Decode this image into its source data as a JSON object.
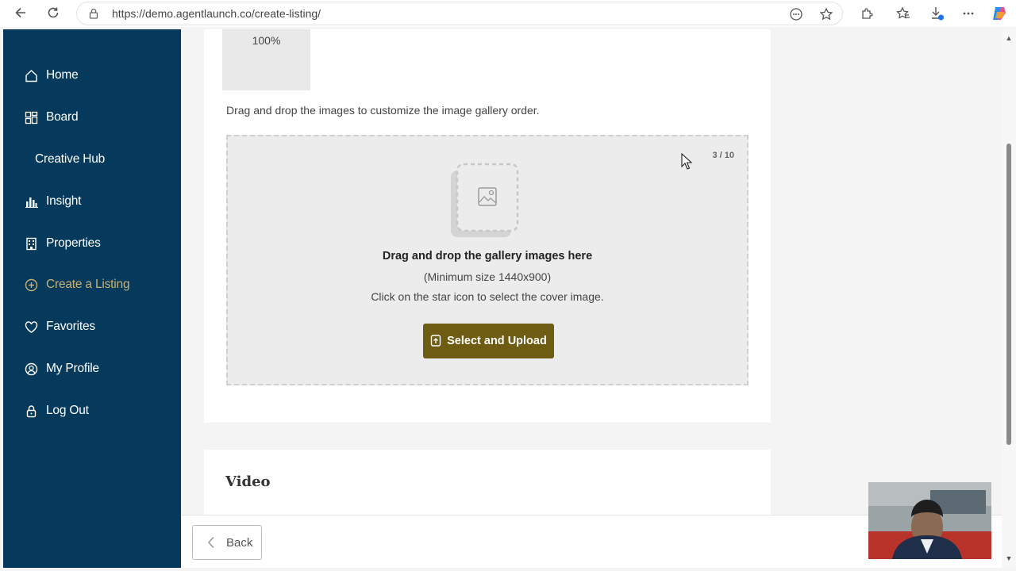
{
  "browser": {
    "url": "https://demo.agentlaunch.co/create-listing/"
  },
  "sidebar": {
    "items": [
      {
        "label": "Home",
        "icon": "home-icon"
      },
      {
        "label": "Board",
        "icon": "board-icon"
      },
      {
        "label": "Creative Hub",
        "icon": ""
      },
      {
        "label": "Insight",
        "icon": "bar-chart-icon"
      },
      {
        "label": "Properties",
        "icon": "building-icon"
      },
      {
        "label": "Create a Listing",
        "icon": "plus-circle-icon",
        "active": true
      },
      {
        "label": "Favorites",
        "icon": "heart-icon"
      },
      {
        "label": "My Profile",
        "icon": "user-circle-icon"
      },
      {
        "label": "Log Out",
        "icon": "lock-icon"
      }
    ],
    "colors": {
      "background": "#053a5c",
      "active": "#c9b074"
    }
  },
  "gallery": {
    "progress_label": "100%",
    "hint": "Drag and drop the images to customize the image gallery order.",
    "dropzone": {
      "count": "3 / 10",
      "title": "Drag and drop the gallery images here",
      "min_size": "(Minimum size 1440x900)",
      "cover_hint": "Click on the star icon to select the cover image.",
      "upload_label": "Select and Upload"
    },
    "colors": {
      "upload_button": "#6e5c12"
    }
  },
  "video": {
    "title": "Video"
  },
  "footer": {
    "back_label": "Back"
  }
}
